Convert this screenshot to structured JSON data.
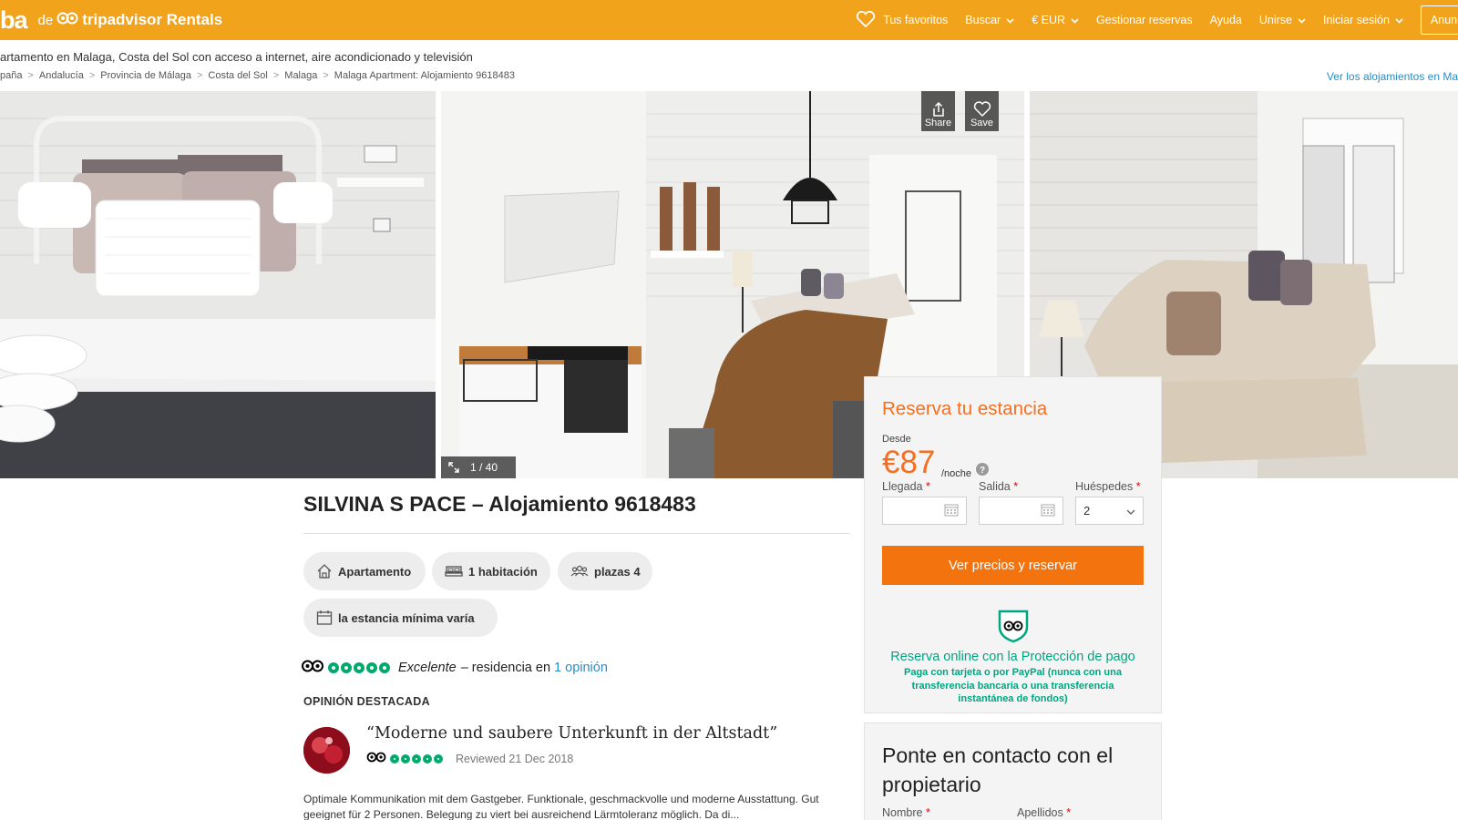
{
  "header": {
    "brand_prefix": "ba",
    "brand_de": "de",
    "brand_name": "tripadvisor Rentals",
    "favorites": "Tus favoritos",
    "search": "Buscar",
    "currency": "€ EUR",
    "manage": "Gestionar reservas",
    "help": "Ayuda",
    "join": "Unirse",
    "signin": "Iniciar sesión",
    "list_property": "Anuncia tu"
  },
  "page_subtitle": "artamento en Malaga, Costa del Sol con acceso a internet, aire acondicionado y televisión",
  "breadcrumb": [
    "paña",
    "Andalucía",
    "Provincia de Málaga",
    "Costa del Sol",
    "Malaga",
    "Malaga Apartment: Alojamiento 9618483"
  ],
  "see_all_link": "Ver los alojamientos en Ma",
  "gallery": {
    "share": "Share",
    "save": "Save",
    "counter": "1 / 40"
  },
  "listing": {
    "title": "SILVINA S PACE – Alojamiento 9618483",
    "chips": {
      "type": "Apartamento",
      "rooms": "1 habitación",
      "guests": "plazas 4",
      "stay": "la estancia mínima varía"
    },
    "rating_word": "Excelente",
    "rating_rest": "– residencia en",
    "rating_link": "1 opinión",
    "rating_bubbles": 5
  },
  "featured_review": {
    "heading": "OPINIÓN DESTACADA",
    "title": "“Moderne und saubere Unterkunft in der Altstadt”",
    "date": "Reviewed 21 Dec 2018",
    "bubbles": 5,
    "body": "Optimale Kommunikation mit dem Gastgeber. Funktionale, geschmackvolle und moderne Ausstattung. Gut geeignet für 2 Personen. Belegung zu viert bei ausreichend Lärmtoleranz möglich. Da di..."
  },
  "booking": {
    "title": "Reserva tu estancia",
    "from_label": "Desde",
    "price": "€87",
    "per_night": "/noche",
    "arrival_label": "Llegada",
    "departure_label": "Salida",
    "guests_label": "Huéspedes",
    "required_mark": "*",
    "arrival_value": "",
    "departure_value": "",
    "guests_value": "2",
    "cta": "Ver precios y reservar",
    "protection_title": "Reserva online con la Protección de pago",
    "protection_text": "Paga con tarjeta o por PayPal (nunca con una transferencia bancaria o una transferencia instantánea de fondos)"
  },
  "contact": {
    "title": "Ponte en contacto con el propietario",
    "first_name_label": "Nombre",
    "last_name_label": "Apellidos",
    "required_mark": "*"
  },
  "colors": {
    "header_bg": "#f2a31c",
    "accent_orange": "#f36f21",
    "cta_orange": "#f3730f",
    "trust_green": "#00a680",
    "link_blue": "#2b8cc4"
  }
}
